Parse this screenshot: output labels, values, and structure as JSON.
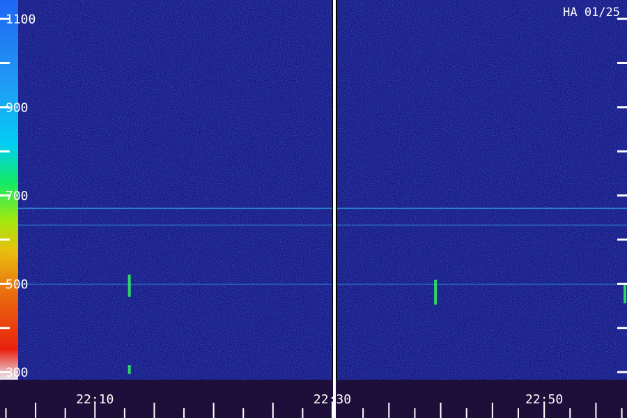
{
  "chart_data": {
    "type": "heatmap",
    "title": "HA 01/25",
    "xlabel": "",
    "ylabel": "",
    "y_axis": {
      "labels": [
        "1100",
        "900",
        "700",
        "500",
        "300"
      ],
      "values": [
        1100,
        900,
        700,
        500,
        300
      ],
      "minor_values": [
        1000,
        800,
        600,
        400
      ],
      "range": [
        282,
        1142
      ]
    },
    "x_axis": {
      "labels": [
        "22:10",
        "22:30",
        "22:50"
      ],
      "values": [
        "22:10",
        "22:30",
        "22:50"
      ],
      "range": [
        "22:02",
        "22:58"
      ],
      "tick_interval_minutes": 2.5,
      "gap_after": "22:30"
    },
    "background_intensity": "low (dark blue noise)",
    "features": [
      {
        "type": "horizontal_band",
        "frequency": 670,
        "intensity": "moderate"
      },
      {
        "type": "horizontal_band",
        "frequency": 632,
        "intensity": "weak"
      },
      {
        "type": "horizontal_band",
        "frequency": 498,
        "intensity": "weak"
      },
      {
        "type": "vertical_burst",
        "time": "22:12.9",
        "freq_range": [
          470,
          520
        ],
        "intensity": "moderate"
      },
      {
        "type": "vertical_burst",
        "time": "22:12.9",
        "freq_range": [
          295,
          315
        ],
        "intensity": "moderate"
      },
      {
        "type": "vertical_burst",
        "time": "22:39.5",
        "freq_range": [
          452,
          508
        ],
        "intensity": "moderate"
      },
      {
        "type": "vertical_burst",
        "time": "22:58",
        "freq_range": [
          455,
          500
        ],
        "intensity": "moderate"
      }
    ],
    "colorbar": {
      "position": "left edge",
      "colors": [
        "#1a00a0",
        "#1e90ff",
        "#00ffff",
        "#00ff40",
        "#ffff00",
        "#ff8000",
        "#ff0000",
        "#ffffff"
      ]
    },
    "grid": false
  }
}
